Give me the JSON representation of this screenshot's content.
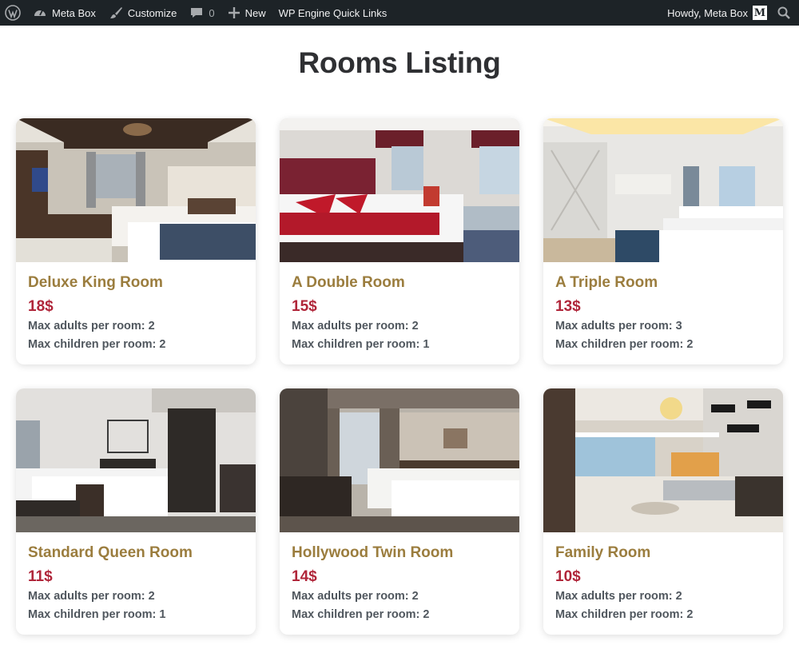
{
  "adminbar": {
    "site_name": "Meta Box",
    "customize_label": "Customize",
    "comments_count": "0",
    "new_label": "New",
    "quicklinks_label": "WP Engine Quick Links",
    "greeting": "Howdy, Meta Box",
    "avatar_letter": "M"
  },
  "page": {
    "title": "Rooms Listing"
  },
  "labels": {
    "max_adults": "Max adults per room:",
    "max_children": "Max children per room:"
  },
  "rooms": [
    {
      "title": "Deluxe King Room",
      "price": "18$",
      "adults": "Max adults per room: 2",
      "children": "Max children per room: 2"
    },
    {
      "title": "A Double Room",
      "price": "15$",
      "adults": "Max adults per room: 2",
      "children": "Max children per room: 1"
    },
    {
      "title": "A Triple Room",
      "price": "13$",
      "adults": "Max adults per room: 3",
      "children": "Max children per room: 2"
    },
    {
      "title": "Standard Queen Room",
      "price": "11$",
      "adults": "Max adults per room: 2",
      "children": "Max children per room: 1"
    },
    {
      "title": "Hollywood Twin Room",
      "price": "14$",
      "adults": "Max adults per room: 2",
      "children": "Max children per room: 2"
    },
    {
      "title": "Family Room",
      "price": "10$",
      "adults": "Max adults per room: 2",
      "children": "Max children per room: 2"
    }
  ],
  "colors": {
    "adminbar_bg": "#1d2327",
    "room_title": "#9b7d3e",
    "room_price": "#b0263a"
  }
}
